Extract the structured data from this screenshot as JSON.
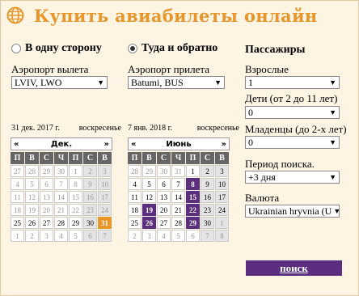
{
  "header": {
    "title": "Купить авиабилеты онлайн",
    "icon": "globe-icon",
    "accent": "#e8962a"
  },
  "trip_type": {
    "one_way": "В одну сторону",
    "round_trip": "Туда и обратно",
    "selected": "round_trip"
  },
  "departure": {
    "label": "Аэропорт вылета",
    "value": "LVIV, LWO"
  },
  "arrival": {
    "label": "Аэропорт прилета",
    "value": "Batumi, BUS"
  },
  "passengers": {
    "title": "Пассажиры",
    "adults": {
      "label": "Взрослые",
      "value": "1"
    },
    "children": {
      "label": "Дети (от 2 до 11 лет)",
      "value": "0"
    },
    "infants": {
      "label": "Младенцы (до 2-х лет)",
      "value": "0"
    },
    "period": {
      "label": "Период поиска.",
      "value": "+3 дня"
    },
    "currency": {
      "label": "Валюта",
      "value": "Ukrainian hryvnia (U"
    }
  },
  "calendar_left": {
    "date_text": "31 дек. 2017 г.",
    "weekday_text": "воскресенье",
    "month": "Дек.",
    "prev": "«",
    "next": "»",
    "weekdays": [
      "П",
      "В",
      "С",
      "Ч",
      "П",
      "С",
      "В"
    ],
    "rows": [
      [
        "27",
        "28",
        "29",
        "30",
        "1",
        "2",
        "3"
      ],
      [
        "4",
        "5",
        "6",
        "7",
        "8",
        "9",
        "10"
      ],
      [
        "11",
        "12",
        "13",
        "14",
        "15",
        "16",
        "17"
      ],
      [
        "18",
        "19",
        "20",
        "21",
        "22",
        "23",
        "24"
      ],
      [
        "25",
        "26",
        "27",
        "28",
        "29",
        "30",
        "31"
      ],
      [
        "1",
        "2",
        "3",
        "4",
        "5",
        "6",
        "7"
      ]
    ]
  },
  "calendar_right": {
    "date_text": "7 янв. 2018 г.",
    "weekday_text": "воскресенье",
    "month": "Июнь",
    "prev": "«",
    "next": "»",
    "weekdays": [
      "П",
      "В",
      "С",
      "Ч",
      "П",
      "С",
      "В"
    ],
    "rows": [
      [
        "28",
        "29",
        "30",
        "31",
        "1",
        "2",
        "3"
      ],
      [
        "4",
        "5",
        "6",
        "7",
        "8",
        "9",
        "10"
      ],
      [
        "11",
        "12",
        "13",
        "14",
        "15",
        "16",
        "17"
      ],
      [
        "18",
        "19",
        "20",
        "21",
        "22",
        "23",
        "24"
      ],
      [
        "25",
        "26",
        "27",
        "28",
        "29",
        "30",
        "1"
      ],
      [
        "2",
        "3",
        "4",
        "5",
        "6",
        "7",
        "8"
      ]
    ]
  },
  "search_button": "поиск",
  "colors": {
    "orange": "#e8962a",
    "purple": "#5b2e80",
    "background": "#fdf4e4"
  }
}
